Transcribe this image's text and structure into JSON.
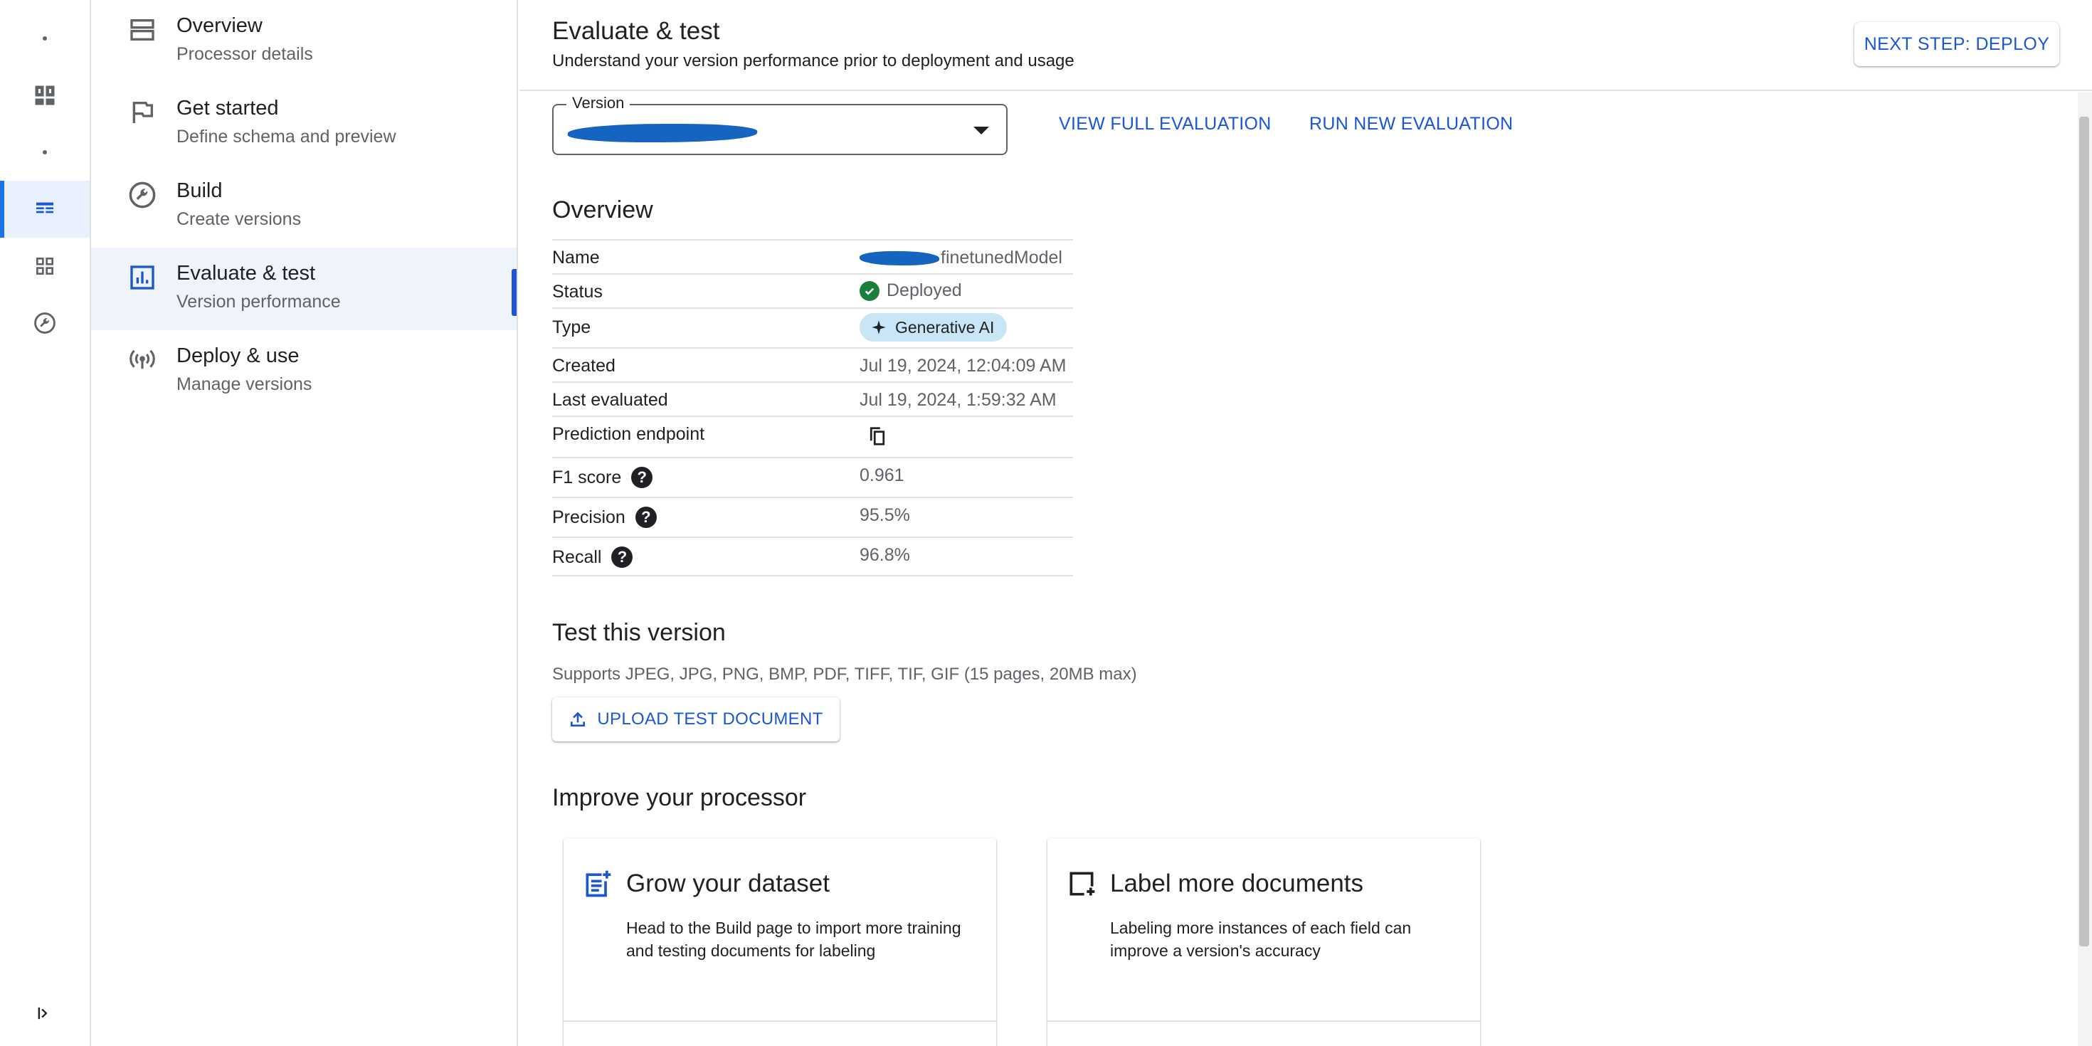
{
  "rail": {
    "items": [
      {
        "name": "rail-dot-1",
        "icon": "dot"
      },
      {
        "name": "rail-dashboard",
        "icon": "dashboard-icon"
      },
      {
        "name": "rail-dot-2",
        "icon": "dot"
      },
      {
        "name": "rail-document-ai",
        "icon": "document-ai-icon",
        "active": true
      },
      {
        "name": "rail-apps",
        "icon": "apps-grid-icon"
      },
      {
        "name": "rail-settings",
        "icon": "wrench-circle-icon"
      }
    ],
    "expand_icon": "expand-nav-icon"
  },
  "nav": {
    "items": [
      {
        "title": "Overview",
        "subtitle": "Processor details",
        "icon": "storage-icon"
      },
      {
        "title": "Get started",
        "subtitle": "Define schema and preview",
        "icon": "flag-icon"
      },
      {
        "title": "Build",
        "subtitle": "Create versions",
        "icon": "build-icon"
      },
      {
        "title": "Evaluate & test",
        "subtitle": "Version performance",
        "icon": "analytics-icon",
        "active": true
      },
      {
        "title": "Deploy & use",
        "subtitle": "Manage versions",
        "icon": "broadcast-icon"
      }
    ]
  },
  "header": {
    "title": "Evaluate & test",
    "subtitle": "Understand your version performance prior to deployment and usage",
    "next_step_label": "NEXT STEP: DEPLOY"
  },
  "version": {
    "label": "Version",
    "view_full_label": "VIEW FULL EVALUATION",
    "run_new_label": "RUN NEW EVALUATION"
  },
  "overview": {
    "title": "Overview",
    "rows": {
      "name": {
        "key": "Name",
        "value": "finetunedModel"
      },
      "status": {
        "key": "Status",
        "value": "Deployed"
      },
      "type": {
        "key": "Type",
        "value": "Generative AI"
      },
      "created": {
        "key": "Created",
        "value": "Jul 19, 2024, 12:04:09 AM"
      },
      "last_evaluated": {
        "key": "Last evaluated",
        "value": "Jul 19, 2024, 1:59:32 AM"
      },
      "endpoint": {
        "key": "Prediction endpoint"
      },
      "f1": {
        "key": "F1 score",
        "value": "0.961"
      },
      "precision": {
        "key": "Precision",
        "value": "95.5%"
      },
      "recall": {
        "key": "Recall",
        "value": "96.8%"
      }
    },
    "help_glyph": "?"
  },
  "test": {
    "title": "Test this version",
    "supports": "Supports JPEG, JPG, PNG, BMP, PDF, TIFF, TIF, GIF (15 pages, 20MB max)",
    "upload_label": "UPLOAD TEST DOCUMENT"
  },
  "improve": {
    "title": "Improve your processor",
    "cards": [
      {
        "title": "Grow your dataset",
        "body": "Head to the Build page to import more training and testing documents for labeling",
        "icon": "post-add-icon"
      },
      {
        "title": "Label more documents",
        "body": "Labeling more instances of each field can improve a version's accuracy",
        "icon": "add-box-icon"
      }
    ]
  },
  "colors": {
    "accent": "#1a56d6",
    "success": "#188038",
    "chip_bg": "#c8e6f5",
    "redaction": "#1565c0"
  }
}
